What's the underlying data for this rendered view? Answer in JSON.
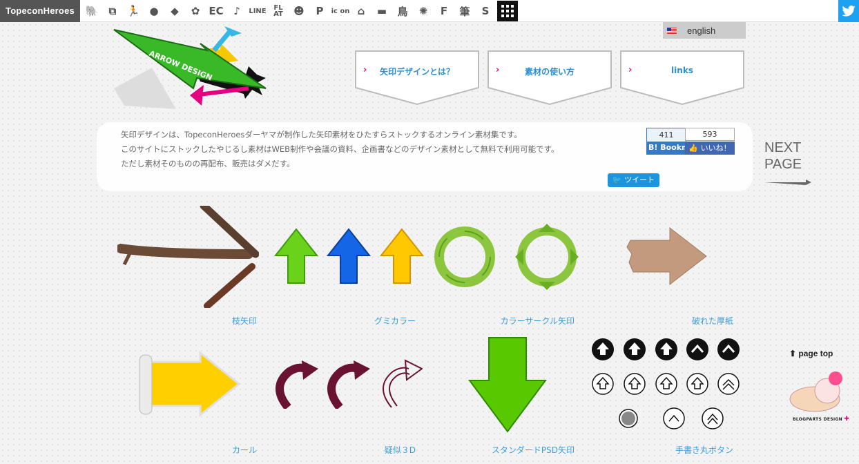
{
  "header": {
    "brand": "TopeconHeroes",
    "nav_icons": [
      {
        "name": "elephant-icon",
        "glyph": "🐘"
      },
      {
        "name": "copy-icon",
        "glyph": "⧉"
      },
      {
        "name": "person-icon",
        "glyph": "🏃"
      },
      {
        "name": "speech-bubble-icon",
        "glyph": "●"
      },
      {
        "name": "tag-icon",
        "glyph": "◆"
      },
      {
        "name": "flower-icon",
        "glyph": "✿"
      },
      {
        "name": "ec-icon",
        "glyph": "EC"
      },
      {
        "name": "music-note-icon",
        "glyph": "♪"
      },
      {
        "name": "line-icon",
        "glyph": "LINE"
      },
      {
        "name": "flat-icon",
        "glyph": "FL AT"
      },
      {
        "name": "smiley-icon",
        "glyph": "☻"
      },
      {
        "name": "parking-icon",
        "glyph": "P"
      },
      {
        "name": "icon-text-icon",
        "glyph": "ic on"
      },
      {
        "name": "building-icon",
        "glyph": "⌂"
      },
      {
        "name": "bench-icon",
        "glyph": "▬"
      },
      {
        "name": "bird-kanji-icon",
        "glyph": "鳥"
      },
      {
        "name": "badge-icon",
        "glyph": "✺"
      },
      {
        "name": "f-logo-icon",
        "glyph": "F"
      },
      {
        "name": "brush-kanji-icon",
        "glyph": "筆"
      },
      {
        "name": "s-logo-icon",
        "glyph": "S"
      }
    ],
    "grid_icon": "grid-icon",
    "twitter_icon": "twitter-icon",
    "accent": "#1da1f2"
  },
  "language": {
    "label": "english"
  },
  "menu": [
    {
      "label": "矢印デザインとは？"
    },
    {
      "label": "素材の使い方"
    },
    {
      "label": "links"
    }
  ],
  "intro": {
    "lines": [
      "矢印デザインは、TopeconHeroesダーヤマが制作した矢印素材をひたすらストックするオンライン素材集です。",
      "このサイトにストックしたやじるし素材はWEB制作や会議の資料、企画書などのデザイン素材として無料で利用可能です。",
      "ただし素材そのものの再配布、販売はダメだす。"
    ]
  },
  "social": {
    "hatena_count": "411",
    "hatena_label": "B! Bookmark",
    "fb_count": "593",
    "fb_label": "いいね！",
    "tweet_label": "ツイート"
  },
  "next_page": {
    "line1": "NEXT",
    "line2": "PAGE"
  },
  "gallery": [
    {
      "caption": "枝矢印"
    },
    {
      "caption": "グミカラー"
    },
    {
      "caption": "カラーサークル矢印"
    },
    {
      "caption": "破れた厚紙"
    },
    {
      "caption": "カール"
    },
    {
      "caption": "疑似３D"
    },
    {
      "caption": "スタンダードPSD矢印"
    },
    {
      "caption": "手書き丸ボタン"
    }
  ],
  "page_top": {
    "label": "page top"
  },
  "blogparts": {
    "label": "BLOGPARTS DESIGN"
  }
}
